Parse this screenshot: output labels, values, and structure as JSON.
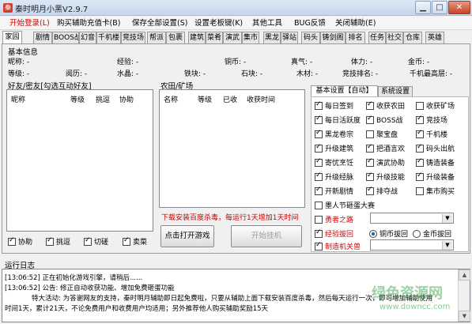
{
  "window": {
    "title": "秦时明月小黑V2.9.7",
    "icon": "app-logo-icon"
  },
  "menu": [
    {
      "label": "开始登录(L)",
      "accent": true
    },
    {
      "label": "购买辅助充值卡(B)"
    },
    {
      "label": "保存全部设置(S)"
    },
    {
      "label": "设置老板键(K)"
    },
    {
      "label": "其他工具"
    },
    {
      "label": "BUG反馈"
    },
    {
      "label": "关闭辅助(E)"
    }
  ],
  "tabs": [
    "家园",
    "剧情",
    "BOOS战",
    "幻音",
    "千机楼",
    "竞技场",
    "帮派",
    "包裹",
    "建筑",
    "菜肴",
    "演武",
    "集市",
    "黑龙",
    "驿站",
    "码头",
    "铸剑阁",
    "排名",
    "任务",
    "社交",
    "仓库",
    "英雄"
  ],
  "basic_info": {
    "title": "基本信息",
    "row1": [
      {
        "label": "昵称:",
        "value": "-"
      },
      {
        "label": "经验:",
        "value": "-"
      },
      {
        "label": "铜币:",
        "value": "-"
      },
      {
        "label": "真气:",
        "value": "-"
      },
      {
        "label": "体力:",
        "value": "-"
      },
      {
        "label": "金币:",
        "value": "-"
      }
    ],
    "row2": [
      {
        "label": "等级:",
        "value": "-"
      },
      {
        "label": "阅历:",
        "value": "-"
      },
      {
        "label": "水晶:",
        "value": "-"
      },
      {
        "label": "铁块:",
        "value": "-"
      },
      {
        "label": "石块:",
        "value": "-"
      },
      {
        "label": "木材:",
        "value": "-"
      },
      {
        "label": "竞技排名:",
        "value": "-"
      },
      {
        "label": "千机最高层:",
        "value": "-"
      }
    ]
  },
  "friends": {
    "title": "好友/密友[勾选互动好友]",
    "columns": [
      "昵称",
      "等级",
      "挑逗",
      "协助"
    ],
    "checks": [
      {
        "label": "协助",
        "checked": true
      },
      {
        "label": "挑逗",
        "checked": true
      },
      {
        "label": "切磋",
        "checked": true
      },
      {
        "label": "卖菜",
        "checked": true
      }
    ]
  },
  "farm": {
    "title": "农田/矿场",
    "columns": [
      "名称",
      "等级",
      "已收",
      "收获时间"
    ],
    "promo": "下载安装百度杀毒，每运行1天增加1天时间",
    "open_button": "点击打开游戏",
    "hang_button": "开始挂机"
  },
  "settings": {
    "tabs": [
      "基本设置【自动】",
      "系统设置"
    ],
    "options": [
      {
        "label": "每日签到",
        "checked": true
      },
      {
        "label": "收获农田",
        "checked": true
      },
      {
        "label": "收获矿场",
        "checked": false
      },
      {
        "label": "每日活跃度",
        "checked": true
      },
      {
        "label": "BOSS战",
        "checked": true
      },
      {
        "label": "竞技场",
        "checked": true
      },
      {
        "label": "黑龙卷宗",
        "checked": true
      },
      {
        "label": "聚宝盘",
        "checked": false
      },
      {
        "label": "千机楼",
        "checked": true
      },
      {
        "label": "升级建筑",
        "checked": true
      },
      {
        "label": "把酒言欢",
        "checked": true
      },
      {
        "label": "码头出航",
        "checked": true
      },
      {
        "label": "寄忧烹饪",
        "checked": true
      },
      {
        "label": "演武协助",
        "checked": true
      },
      {
        "label": "铸造装备",
        "checked": true
      },
      {
        "label": "升级经脉",
        "checked": true
      },
      {
        "label": "升级技能",
        "checked": true
      },
      {
        "label": "升级装备",
        "checked": true
      },
      {
        "label": "开新剧情",
        "checked": true
      },
      {
        "label": "排夺战",
        "checked": true
      },
      {
        "label": "集市购买",
        "checked": false
      }
    ],
    "egg": {
      "label": "墨人节砸蛋大赛",
      "checked": false
    },
    "hero_path": {
      "label": "勇者之路",
      "checked": false
    },
    "auto_pick": {
      "label": "经验拔回",
      "checked": true,
      "radio1": "铜币拔回",
      "radio2": "金币拔回",
      "selected": 1
    },
    "mech_beast": {
      "label": "制造机关兽",
      "checked": true
    }
  },
  "log": {
    "title": "运行日志",
    "lines": [
      "[13:06:52] 正在初始化游戏引擎，请稍后......",
      "[13:06:52] 公告: 修正自动收获功能、增加免费砸蛋功能",
      "特大活动: 为答谢网友的支持，秦时明月辅助即日起免费啦，只要从辅助上面下载安装百度杀毒，然后每天运行一次，即可增加辅助使用",
      "时间1天，累计21天，不论免费用户和收费用户均适用；另外推荐他人购买辅助奖励15天"
    ]
  },
  "watermark": {
    "line1": "绿色资源网",
    "line2": "www.downcc.com"
  }
}
